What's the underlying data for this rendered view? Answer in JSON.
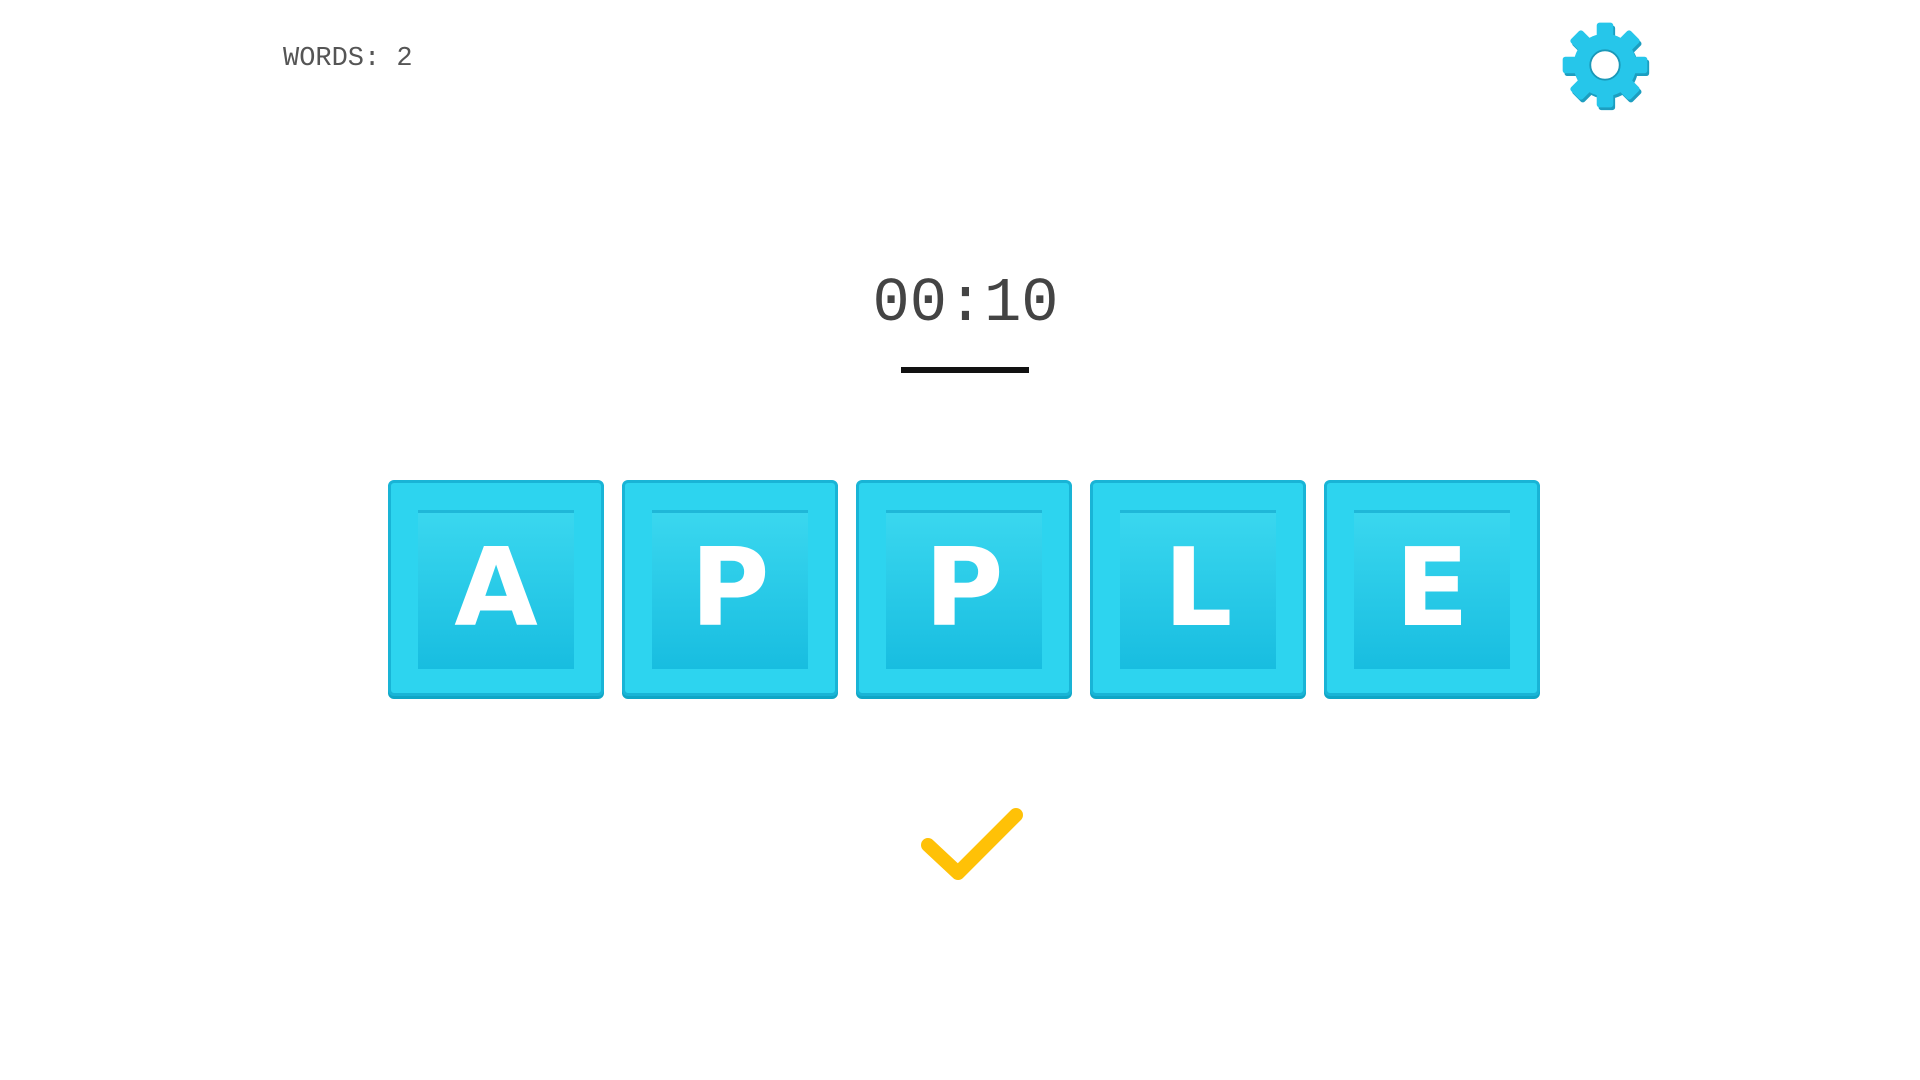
{
  "hud": {
    "words_label": "WORDS: 2",
    "timer": "00:10"
  },
  "tiles": [
    {
      "letter": "A"
    },
    {
      "letter": "P"
    },
    {
      "letter": "P"
    },
    {
      "letter": "L"
    },
    {
      "letter": "E"
    }
  ],
  "icons": {
    "settings": "gear-icon",
    "submit": "checkmark-icon"
  },
  "colors": {
    "tile": "#2dd4ef",
    "gear": "#22c2e6",
    "check": "#ffc107"
  }
}
